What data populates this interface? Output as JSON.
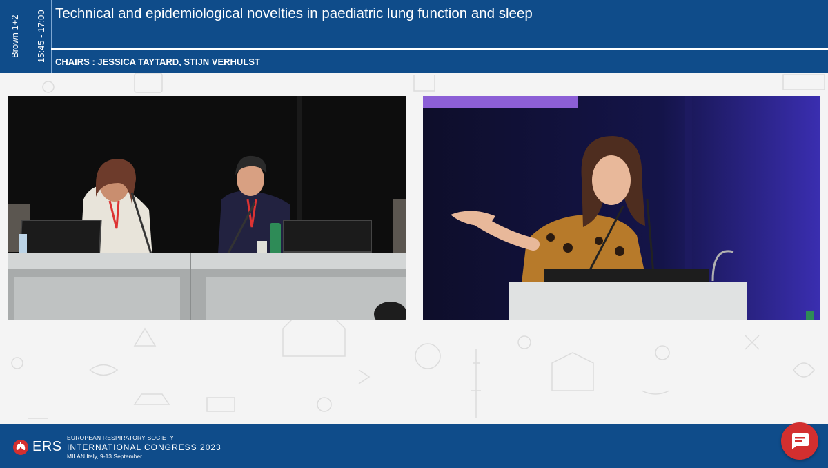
{
  "header": {
    "room": "Brown 1+2",
    "time": "15:45 - 17:00",
    "title": "Technical and epidemiological novelties in paediatric lung function and sleep",
    "chairs": "CHAIRS : JESSICA TAYTARD, STIJN VERHULST"
  },
  "videos": {
    "left": {
      "description_icon": "video-feed-chairs"
    },
    "right": {
      "description_icon": "video-feed-speaker"
    }
  },
  "footer": {
    "brand": "ERS",
    "society": "EUROPEAN RESPIRATORY SOCIETY",
    "congress": "INTERNATIONAL CONGRESS 2023",
    "venue": "MILAN Italy, 9-13 September"
  },
  "chat": {
    "icon": "chat-icon"
  },
  "colors": {
    "brand_blue": "#0f4c8a",
    "chat_red": "#d32f2f",
    "background": "#f4f4f4"
  }
}
